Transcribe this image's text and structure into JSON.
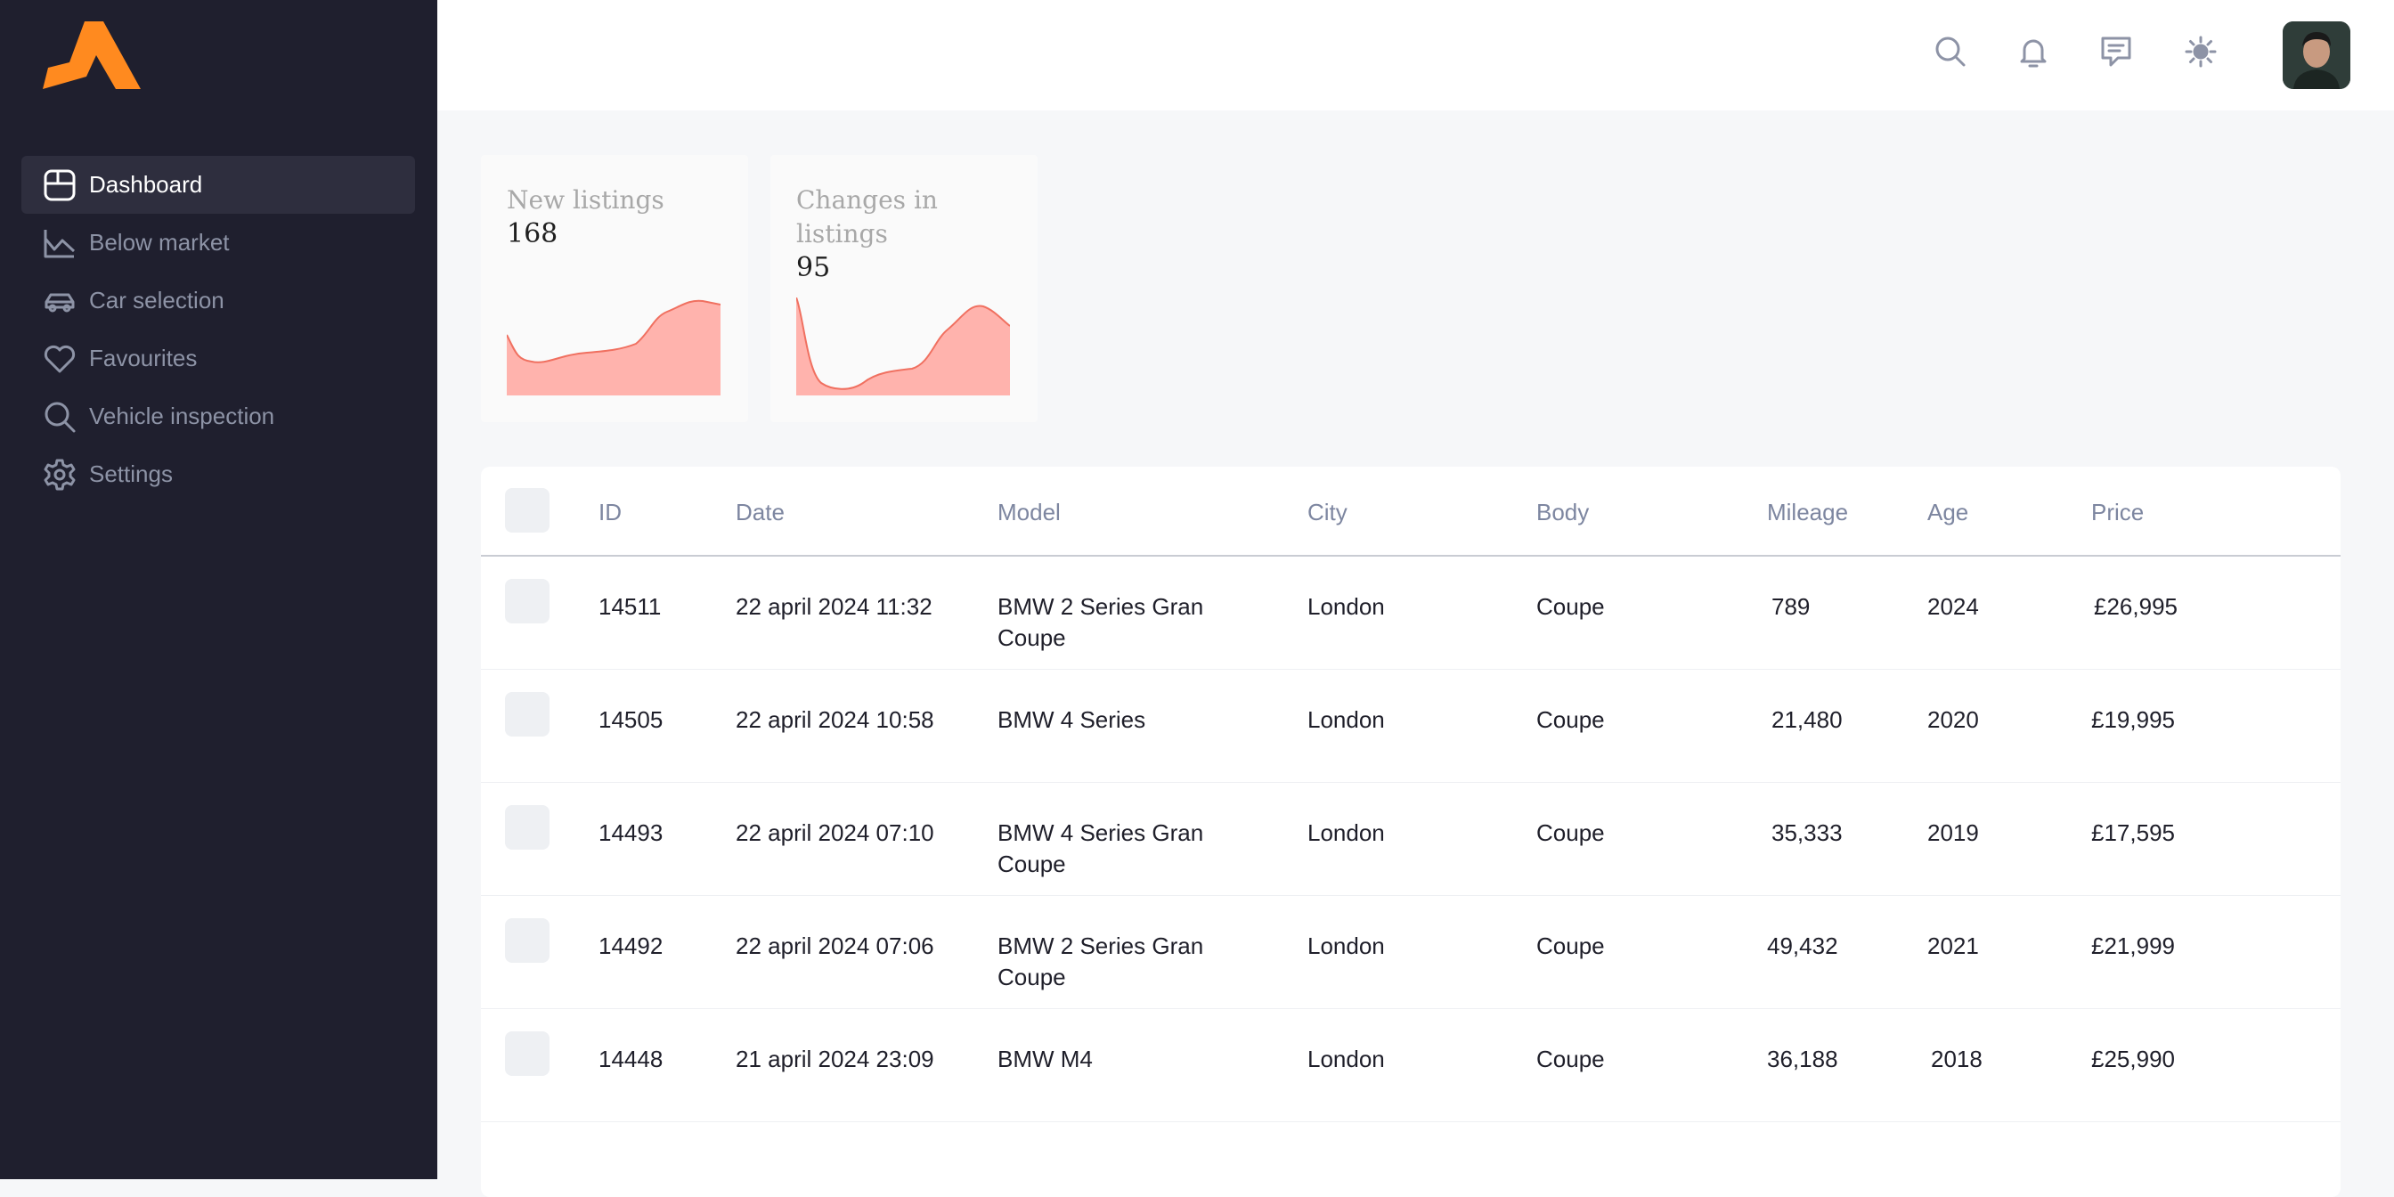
{
  "brand": {
    "accent": "#ff8a1f",
    "sidebar_bg": "#1f1f2e",
    "chart_fill": "#ffb3ad",
    "chart_stroke": "#f07060"
  },
  "sidebar": {
    "items": [
      {
        "label": "Dashboard",
        "icon": "dashboard-icon",
        "active": true
      },
      {
        "label": "Below market",
        "icon": "chart-icon",
        "active": false
      },
      {
        "label": "Car selection",
        "icon": "car-icon",
        "active": false
      },
      {
        "label": "Favourites",
        "icon": "heart-icon",
        "active": false
      },
      {
        "label": "Vehicle inspection",
        "icon": "search-icon",
        "active": false
      },
      {
        "label": "Settings",
        "icon": "gear-icon",
        "active": false
      }
    ]
  },
  "header": {
    "icons": [
      "search-icon",
      "bell-icon",
      "message-icon",
      "sun-icon"
    ]
  },
  "stats": [
    {
      "title": "New listings",
      "value": "168"
    },
    {
      "title": "Changes in listings",
      "value": "95"
    }
  ],
  "table": {
    "columns": [
      "ID",
      "Date",
      "Model",
      "City",
      "Body",
      "Mileage",
      "Age",
      "Price"
    ],
    "rows": [
      {
        "id": "14511",
        "date": "22 april 2024 11:32",
        "model": "BMW 2 Series Gran Coupe",
        "city": "London",
        "body": "Coupe",
        "mileage": "789",
        "age": "2024",
        "price": "£26,995"
      },
      {
        "id": "14505",
        "date": "22 april 2024 10:58",
        "model": "BMW 4 Series",
        "city": "London",
        "body": "Coupe",
        "mileage": "21,480",
        "age": "2020",
        "price": "£19,995"
      },
      {
        "id": "14493",
        "date": "22 april 2024 07:10",
        "model": "BMW 4 Series Gran Coupe",
        "city": "London",
        "body": "Coupe",
        "mileage": "35,333",
        "age": "2019",
        "price": "£17,595"
      },
      {
        "id": "14492",
        "date": "22 april 2024 07:06",
        "model": "BMW 2 Series Gran Coupe",
        "city": "London",
        "body": "Coupe",
        "mileage": "49,432",
        "age": "2021",
        "price": "£21,999"
      },
      {
        "id": "14448",
        "date": "21 april 2024 23:09",
        "model": "BMW M4",
        "city": "London",
        "body": "Coupe",
        "mileage": "36,188",
        "age": "2018",
        "price": "£25,990"
      }
    ]
  }
}
